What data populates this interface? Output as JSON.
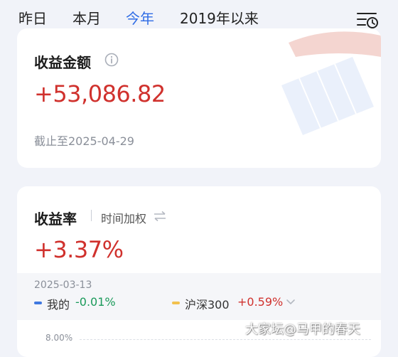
{
  "tabs": [
    {
      "label": "昨日",
      "active": false
    },
    {
      "label": "本月",
      "active": false
    },
    {
      "label": "今年",
      "active": true
    },
    {
      "label": "2019年以来",
      "active": false
    }
  ],
  "header": {
    "filter_icon": "calendar-clock-filter-icon"
  },
  "income_card": {
    "title": "收益金额",
    "info_icon": "info-icon",
    "value": "+53,086.82",
    "as_of": "截止至2025-04-29"
  },
  "rate_card": {
    "title": "收益率",
    "method": "时间加权",
    "swap_icon": "swap-icon",
    "value": "+3.37%",
    "tooltip": {
      "date": "2025-03-13",
      "series": [
        {
          "name": "我的",
          "value": "-0.01%",
          "color": "#3f78e0",
          "value_color": "#1a9a5a"
        },
        {
          "name": "沪深300",
          "value": "+0.59%",
          "color": "#f2c14e",
          "value_color": "#d0312d"
        }
      ]
    },
    "y_axis_top": "8.00%"
  },
  "colors": {
    "accent": "#2f6ce5",
    "positive": "#d0312d",
    "negative": "#1a9a5a"
  },
  "watermark": "大家坛@马甲的春天"
}
